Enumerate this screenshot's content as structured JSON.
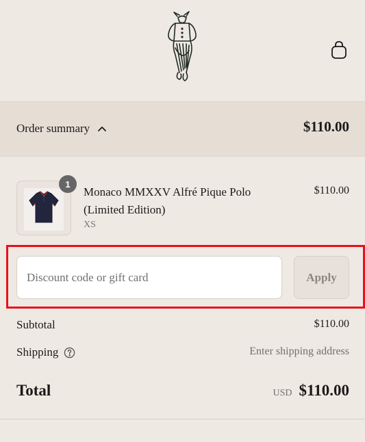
{
  "header": {
    "logo_icon": "boy-sketch-logo-icon",
    "cart_icon": "shopping-bag-icon"
  },
  "summary": {
    "toggle_label": "Order summary",
    "chevron_icon": "chevron-up-icon",
    "total": "$110.00"
  },
  "line_item": {
    "quantity": "1",
    "title": "Monaco MMXXV Alfré Pique Polo (Limited Edition)",
    "variant": "XS",
    "price": "$110.00",
    "image_icon": "navy-polo-shirt-icon"
  },
  "discount": {
    "placeholder": "Discount code or gift card",
    "value": "",
    "apply_label": "Apply"
  },
  "totals": {
    "subtotal_label": "Subtotal",
    "subtotal_value": "$110.00",
    "shipping_label": "Shipping",
    "shipping_help_icon": "question-circle-icon",
    "shipping_value": "Enter shipping address",
    "total_label": "Total",
    "currency": "USD",
    "total_value": "$110.00"
  },
  "colors": {
    "background": "#efe9e3",
    "summary_bar": "#e6ddd5",
    "highlight": "#e8101a",
    "polo": "#22253d"
  }
}
